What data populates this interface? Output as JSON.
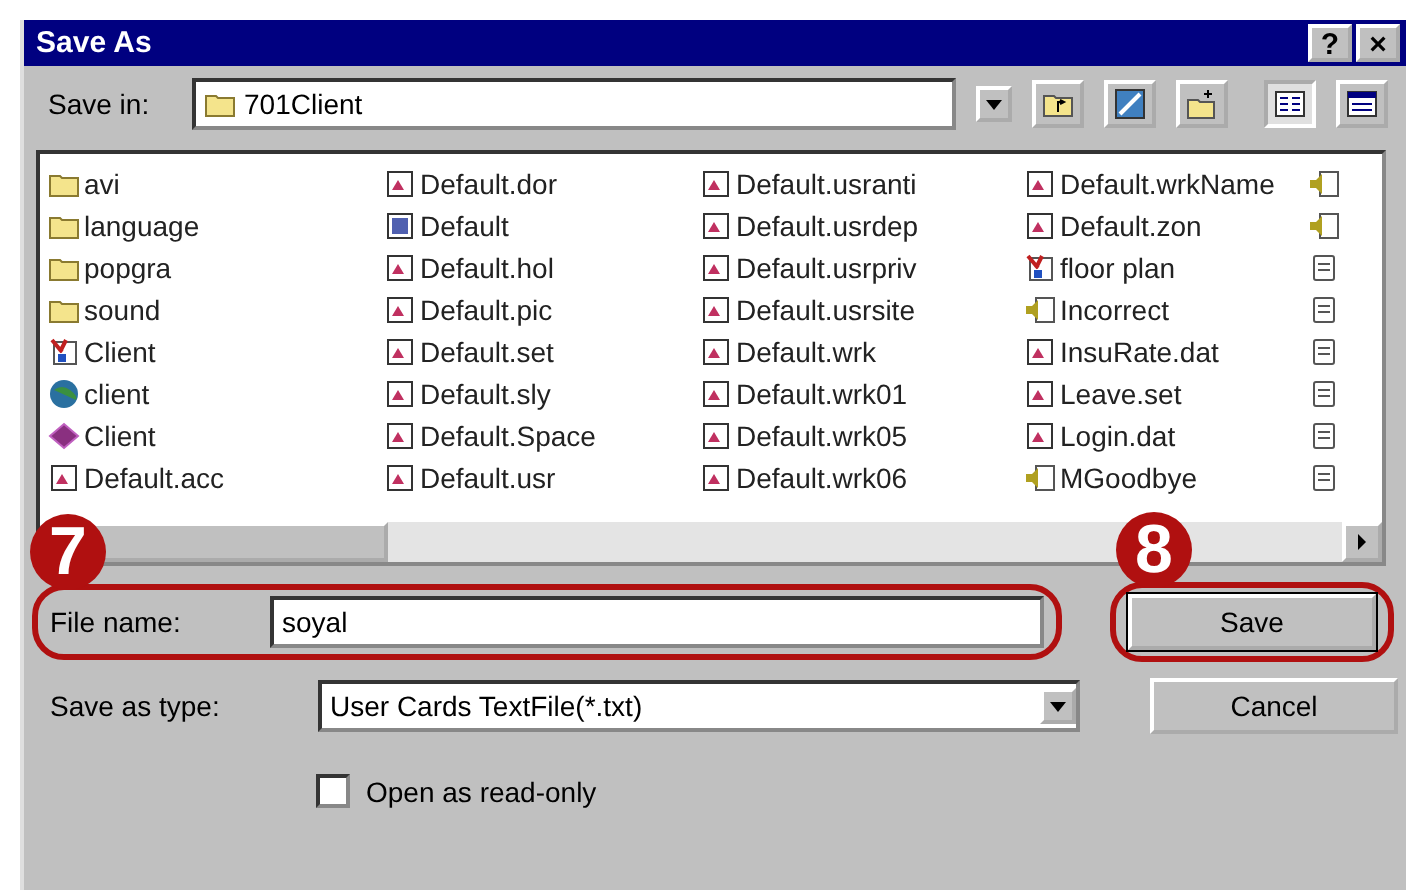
{
  "window": {
    "title": "Save As",
    "title_buttons": [
      "?",
      "×"
    ]
  },
  "save_in": {
    "label": "Save in:",
    "value": "701Client"
  },
  "toolbar": [
    {
      "kind": "up",
      "pressed": false
    },
    {
      "kind": "desktop",
      "pressed": false
    },
    {
      "kind": "newfolder",
      "pressed": false
    },
    {
      "kind": "list",
      "pressed": true
    },
    {
      "kind": "details",
      "pressed": false
    }
  ],
  "files": {
    "columns": [
      [
        {
          "name": "avi",
          "kind": "folder"
        },
        {
          "name": "language",
          "kind": "folder"
        },
        {
          "name": "popgra",
          "kind": "folder"
        },
        {
          "name": "sound",
          "kind": "folder"
        },
        {
          "name": "Client",
          "kind": "app"
        },
        {
          "name": "client",
          "kind": "globe"
        },
        {
          "name": "Client",
          "kind": "book"
        },
        {
          "name": "Default.acc",
          "kind": "file"
        }
      ],
      [
        {
          "name": "Default.dor",
          "kind": "file"
        },
        {
          "name": "Default",
          "kind": "doc"
        },
        {
          "name": "Default.hol",
          "kind": "file"
        },
        {
          "name": "Default.pic",
          "kind": "file"
        },
        {
          "name": "Default.set",
          "kind": "file"
        },
        {
          "name": "Default.sly",
          "kind": "file"
        },
        {
          "name": "Default.Space",
          "kind": "file"
        },
        {
          "name": "Default.usr",
          "kind": "file"
        }
      ],
      [
        {
          "name": "Default.usranti",
          "kind": "file"
        },
        {
          "name": "Default.usrdep",
          "kind": "file"
        },
        {
          "name": "Default.usrpriv",
          "kind": "file"
        },
        {
          "name": "Default.usrsite",
          "kind": "file"
        },
        {
          "name": "Default.wrk",
          "kind": "file"
        },
        {
          "name": "Default.wrk01",
          "kind": "file"
        },
        {
          "name": "Default.wrk05",
          "kind": "file"
        },
        {
          "name": "Default.wrk06",
          "kind": "file"
        }
      ],
      [
        {
          "name": "Default.wrkName",
          "kind": "file"
        },
        {
          "name": "Default.zon",
          "kind": "file"
        },
        {
          "name": "floor plan",
          "kind": "app"
        },
        {
          "name": "Incorrect",
          "kind": "sound"
        },
        {
          "name": "InsuRate.dat",
          "kind": "file"
        },
        {
          "name": "Leave.set",
          "kind": "file"
        },
        {
          "name": "Login.dat",
          "kind": "file"
        },
        {
          "name": "MGoodbye",
          "kind": "sound"
        }
      ],
      [
        {
          "kind": "sound"
        },
        {
          "kind": "sound"
        },
        {
          "kind": "text"
        },
        {
          "kind": "text"
        },
        {
          "kind": "text"
        },
        {
          "kind": "text"
        },
        {
          "kind": "text"
        },
        {
          "kind": "text"
        }
      ]
    ]
  },
  "file_name": {
    "label": "File name:",
    "value": "soyal",
    "callout": "7"
  },
  "save_as_type": {
    "label": "Save as type:",
    "value": "User Cards TextFile(*.txt)"
  },
  "read_only": {
    "label": "Open as read-only",
    "checked": false
  },
  "buttons": [
    {
      "label": "Save",
      "callout": "8"
    },
    {
      "label": "Cancel"
    }
  ]
}
